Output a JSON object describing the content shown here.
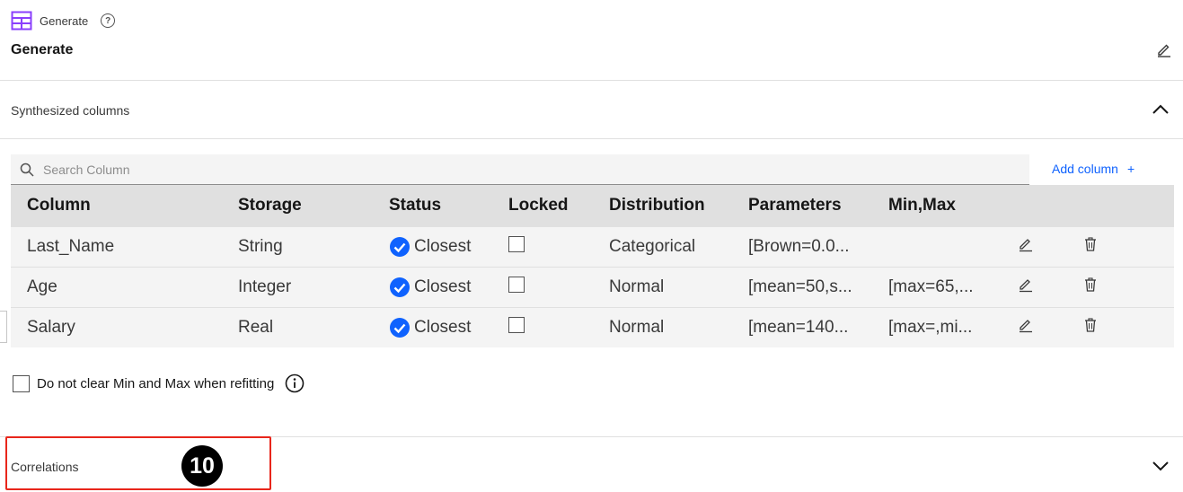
{
  "node": {
    "label": "Generate",
    "title": "Generate",
    "help_glyph": "?"
  },
  "icons": {
    "node": "table-grid-icon",
    "help": "help-icon",
    "edit": "pencil-icon",
    "collapse": "chevron-up-icon",
    "expand": "chevron-down-icon",
    "search": "search-icon",
    "status": "checkmark-filled-icon",
    "delete": "trash-icon",
    "info": "info-icon"
  },
  "sections": {
    "synthesized": {
      "title": "Synthesized columns",
      "expanded": true
    },
    "correlations": {
      "title": "Correlations",
      "expanded": false
    }
  },
  "search": {
    "placeholder": "Search Column"
  },
  "add_column": {
    "label": "Add column",
    "glyph": "+"
  },
  "table": {
    "headers": {
      "column": "Column",
      "storage": "Storage",
      "status": "Status",
      "locked": "Locked",
      "distribution": "Distribution",
      "parameters": "Parameters",
      "minmax": "Min,Max"
    },
    "rows": [
      {
        "column": "Last_Name",
        "storage": "String",
        "status": "Closest",
        "locked": false,
        "distribution": "Categorical",
        "parameters": "[Brown=0.0...",
        "minmax": ""
      },
      {
        "column": "Age",
        "storage": "Integer",
        "status": "Closest",
        "locked": false,
        "distribution": "Normal",
        "parameters": "[mean=50,s...",
        "minmax": "[max=65,..."
      },
      {
        "column": "Salary",
        "storage": "Real",
        "status": "Closest",
        "locked": false,
        "distribution": "Normal",
        "parameters": "[mean=140...",
        "minmax": "[max=,mi..."
      }
    ]
  },
  "refit_option": {
    "label": "Do not clear Min and Max when refitting",
    "checked": false
  },
  "callout": {
    "number": "10"
  },
  "colors": {
    "accent_blue": "#0f62fe",
    "highlight_red": "#e8261b",
    "node_purple": "#8a3ffc"
  }
}
